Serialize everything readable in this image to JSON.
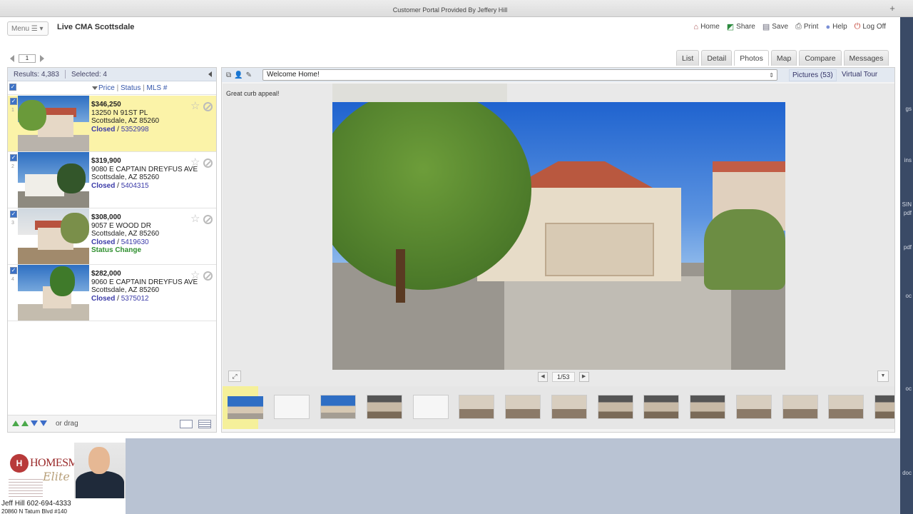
{
  "browser": {
    "title": "Customer Portal Provided By Jeffery Hill",
    "new_tab": "+"
  },
  "header": {
    "menu_label": "Menu",
    "app_title": "Live CMA Scottsdale",
    "links": [
      {
        "label": "Home",
        "icon": "home-icon"
      },
      {
        "label": "Share",
        "icon": "share-icon"
      },
      {
        "label": "Save",
        "icon": "save-icon"
      },
      {
        "label": "Print",
        "icon": "print-icon"
      },
      {
        "label": "Help",
        "icon": "help-icon"
      },
      {
        "label": "Log Off",
        "icon": "power-icon"
      }
    ]
  },
  "pager": {
    "page": "1"
  },
  "tabs": [
    "List",
    "Detail",
    "Photos",
    "Map",
    "Compare",
    "Messages"
  ],
  "results": {
    "count_label": "Results: 4,383",
    "selected_label": "Selected: 4",
    "sort_price": "Price",
    "sort_status": "Status",
    "sort_mls": "MLS #",
    "listings": [
      {
        "num": "1",
        "price": "$346,250",
        "address": "13250 N 91ST PL",
        "city": "Scottsdale, AZ 85260",
        "status": "Closed",
        "mls": "5352998",
        "extra": ""
      },
      {
        "num": "2",
        "price": "$319,900",
        "address": "9080 E CAPTAIN DREYFUS AVE",
        "city": "Scottsdale, AZ 85260",
        "status": "Closed",
        "mls": "5404315",
        "extra": ""
      },
      {
        "num": "3",
        "price": "$308,000",
        "address": "9057 E WOOD DR",
        "city": "Scottsdale, AZ 85260",
        "status": "Closed",
        "mls": "5419630",
        "extra": "Status Change"
      },
      {
        "num": "4",
        "price": "$282,000",
        "address": "9060 E CAPTAIN DREYFUS AVE",
        "city": "Scottsdale, AZ 85260",
        "status": "Closed",
        "mls": "5375012",
        "extra": ""
      }
    ],
    "footer_drag": "or drag"
  },
  "viewer": {
    "dropdown_value": "Welcome Home!",
    "pictures_tab": "Pictures (53)",
    "virtual_tour_tab": "Virtual Tour",
    "caption": "Great curb appeal!",
    "counter": "1/53"
  },
  "agent": {
    "brand": "HOMESMART",
    "brand_sub": "Elite",
    "name_line": "Jeff Hill 602-694-4333",
    "address_line": "20860 N Tatum Blvd #140"
  },
  "side_fragments": [
    "gs",
    "ins",
    "SIN",
    "pdf",
    "pdf",
    "oc",
    "oc",
    "doc"
  ]
}
